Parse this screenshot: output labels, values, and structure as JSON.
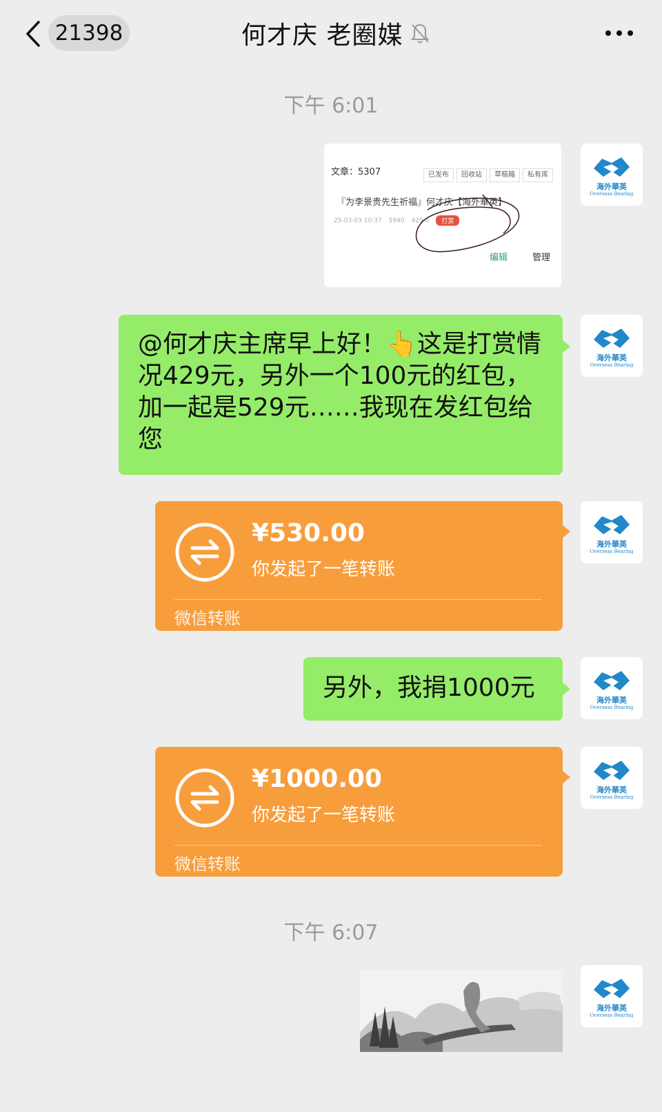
{
  "header": {
    "unread_count": "21398",
    "title": "何才庆  老圈媒"
  },
  "timestamps": [
    "下午 6:01",
    "下午 6:07"
  ],
  "avatar": {
    "label": "海外華英",
    "sub": "Overseas Bearing"
  },
  "screenshot_card": {
    "count_label": "文章：5307",
    "tabs": [
      "已发布",
      "回收站",
      "草稿箱",
      "私有库"
    ],
    "article_title": "『为李景贵先生祈福』何才庆【海外華英】",
    "meta_date": "25-03-03 10:37",
    "meta_views": "5940",
    "meta_reward": "429.0",
    "reward_badge": "打赏",
    "edit_label": "编辑",
    "manage_label": "管理"
  },
  "messages": {
    "text_1": "@何才庆主席早上好！👆这是打赏情况429元，另外一个100元的红包，加一起是529元……我现在发红包给您",
    "text_2": "另外，我捐1000元"
  },
  "transfers": [
    {
      "amount": "¥530.00",
      "desc": "你发起了一笔转账",
      "footer": "微信转账"
    },
    {
      "amount": "¥1000.00",
      "desc": "你发起了一笔转账",
      "footer": "微信转账"
    }
  ],
  "colors": {
    "background": "#ededed",
    "green_bubble": "#95ec69",
    "transfer_orange": "#f89d3c",
    "avatar_blue": "#2188c9"
  }
}
